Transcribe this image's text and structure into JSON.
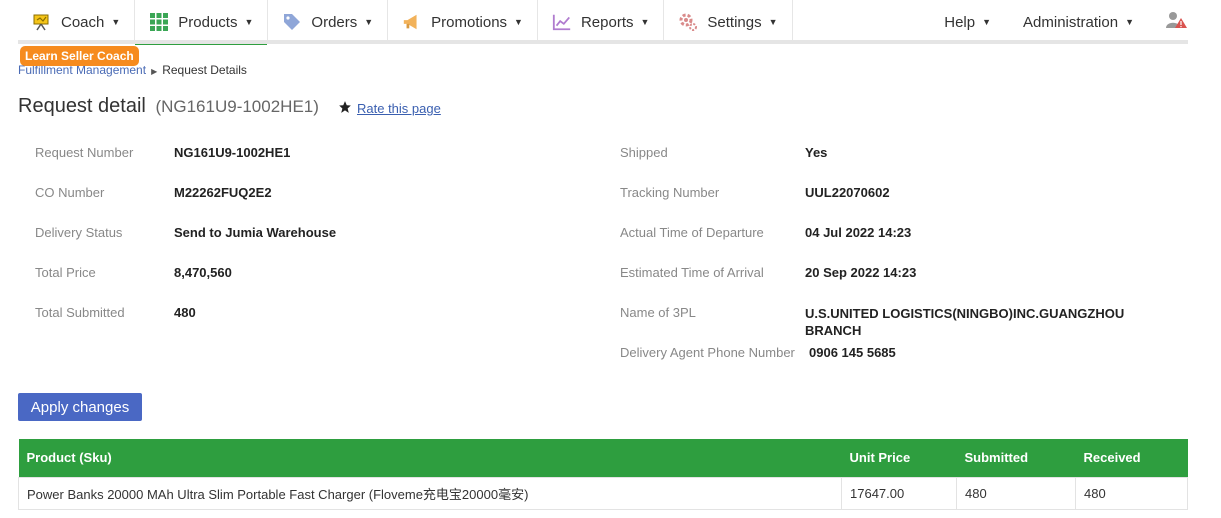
{
  "nav": {
    "items": [
      {
        "label": "Coach"
      },
      {
        "label": "Products"
      },
      {
        "label": "Orders"
      },
      {
        "label": "Promotions"
      },
      {
        "label": "Reports"
      },
      {
        "label": "Settings"
      }
    ],
    "help": "Help",
    "administration": "Administration",
    "active_index": 1
  },
  "coach_badge": "Learn Seller Coach",
  "breadcrumb": {
    "parent": "Fulfillment Management",
    "current": "Request Details"
  },
  "page": {
    "title": "Request detail",
    "subtitle": "(NG161U9-1002HE1)",
    "rate_label": "Rate this page"
  },
  "details_left": [
    {
      "label": "Request Number",
      "value": "NG161U9-1002HE1"
    },
    {
      "label": "CO Number",
      "value": "M22262FUQ2E2"
    },
    {
      "label": "Delivery Status",
      "value": "Send to Jumia Warehouse"
    },
    {
      "label": "Total Price",
      "value": "8,470,560"
    },
    {
      "label": "Total Submitted",
      "value": "480"
    }
  ],
  "details_right": [
    {
      "label": "Shipped",
      "value": "Yes"
    },
    {
      "label": "Tracking Number",
      "value": "UUL22070602"
    },
    {
      "label": "Actual Time of Departure",
      "value": "04 Jul 2022 14:23"
    },
    {
      "label": "Estimated Time of Arrival",
      "value": "20 Sep 2022 14:23"
    },
    {
      "label": "Name of 3PL",
      "value_line1": "U.S.UNITED LOGISTICS(NINGBO)INC.GUANGZHOU",
      "value_line2": "BRANCH"
    },
    {
      "label": "Delivery Agent Phone Number",
      "value": "0906 145 5685"
    }
  ],
  "apply_button": "Apply changes",
  "table": {
    "headers": [
      "Product (Sku)",
      "Unit Price",
      "Submitted",
      "Received"
    ],
    "rows": [
      [
        "Power Banks 20000 MAh Ultra Slim Portable Fast Charger (Floveme充电宝20000毫安)",
        "17647.00",
        "480",
        "480"
      ]
    ]
  },
  "colors": {
    "accent_green": "#2e9e3f",
    "button_blue": "#4a68c4",
    "coach_orange": "#f68b1e"
  }
}
